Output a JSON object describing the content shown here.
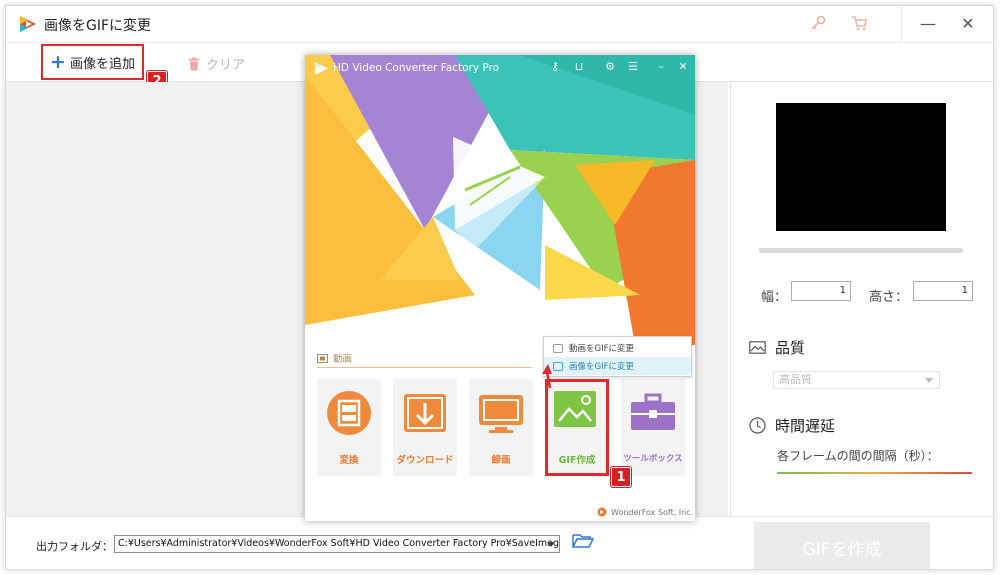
{
  "app": {
    "title": "画像をGIFに変更",
    "accent": "#2a78d4",
    "highlight": "#e0292d"
  },
  "toolbar": {
    "add_label": "画像を追加",
    "clear_label": "クリア",
    "badge_add": "2"
  },
  "right_panel": {
    "width_label": "幅：",
    "width_value": "1",
    "height_label": "高さ：",
    "height_value": "1",
    "quality_title": "品質",
    "quality_value": "高品質",
    "delay_title": "時間遅延",
    "delay_label": "各フレームの間の間隔（秒）："
  },
  "bottom": {
    "output_label": "出力フォルダ：",
    "output_path": "C:¥Users¥Administrator¥Videos¥WonderFox Soft¥HD Video Converter Factory Pro¥SaveImage¥",
    "gif_button": "GIFを作成"
  },
  "hd_window": {
    "title": "HD Video Converter Factory Pro",
    "section_label": "動画",
    "tiles": [
      {
        "label": "変換",
        "color": "#ef8a3c"
      },
      {
        "label": "ダウンロード",
        "color": "#ef8a3c"
      },
      {
        "label": "録画",
        "color": "#ef8a3c"
      },
      {
        "label": "GIF作成",
        "color": "#7ec545"
      },
      {
        "label": "ツールボックス",
        "color": "#9c72c8"
      }
    ],
    "popup_items": [
      "動画をGIFに変更",
      "画像をGIFに変更"
    ],
    "badge_gif": "1",
    "footer": "WonderFox Soft, Inc."
  }
}
